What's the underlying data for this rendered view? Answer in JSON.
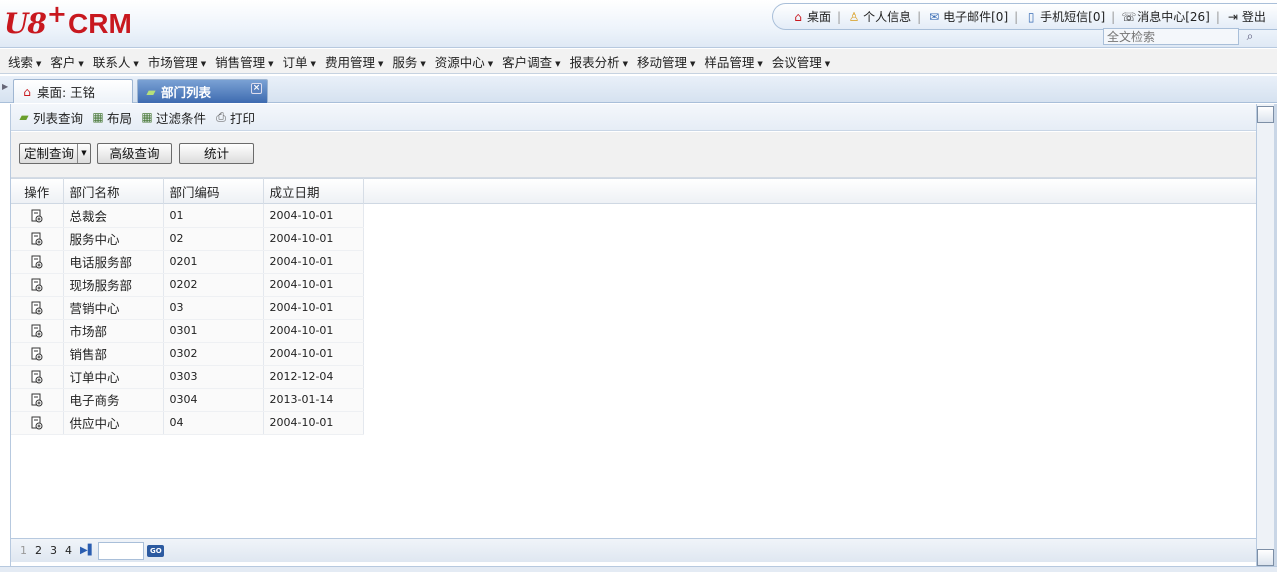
{
  "brand": {
    "u8": "U8",
    "plus": "+",
    "crm": "CRM"
  },
  "toplinks": [
    {
      "label": "桌面",
      "icon": "home-icon",
      "glyph": "⌂"
    },
    {
      "label": "个人信息",
      "icon": "user-icon",
      "glyph": "👤"
    },
    {
      "label": "电子邮件[0]",
      "icon": "mail-icon",
      "glyph": "✉"
    },
    {
      "label": "手机短信[0]",
      "icon": "phone-icon",
      "glyph": "📱"
    },
    {
      "label": "消息中心[26]",
      "icon": "message-center-icon",
      "glyph": "☏"
    },
    {
      "label": "登出",
      "icon": "logout-icon",
      "glyph": "⏻"
    }
  ],
  "search": {
    "placeholder": "全文检索"
  },
  "menu": [
    "线索",
    "客户",
    "联系人",
    "市场管理",
    "销售管理",
    "订单",
    "费用管理",
    "服务",
    "资源中心",
    "客户调查",
    "报表分析",
    "移动管理",
    "样品管理",
    "会议管理"
  ],
  "tabs": [
    {
      "label": "桌面: 王铭",
      "icon": "home-icon"
    },
    {
      "label": "部门列表",
      "icon": "list-icon"
    }
  ],
  "toolbar": {
    "list_query": "列表查询",
    "layout": "布局",
    "filter": "过滤条件",
    "print": "打印"
  },
  "query": {
    "custom": "定制查询",
    "advanced": "高级查询",
    "stats": "统计"
  },
  "table": {
    "headers": [
      "操作",
      "部门名称",
      "部门编码",
      "成立日期"
    ],
    "rows": [
      {
        "name": "总裁会",
        "code": "01",
        "date": "2004-10-01"
      },
      {
        "name": "服务中心",
        "code": "02",
        "date": "2004-10-01"
      },
      {
        "name": "电话服务部",
        "code": "0201",
        "date": "2004-10-01"
      },
      {
        "name": "现场服务部",
        "code": "0202",
        "date": "2004-10-01"
      },
      {
        "name": "营销中心",
        "code": "03",
        "date": "2004-10-01"
      },
      {
        "name": "市场部",
        "code": "0301",
        "date": "2004-10-01"
      },
      {
        "name": "销售部",
        "code": "0302",
        "date": "2004-10-01"
      },
      {
        "name": "订单中心",
        "code": "0303",
        "date": "2012-12-04"
      },
      {
        "name": "电子商务",
        "code": "0304",
        "date": "2013-01-14"
      },
      {
        "name": "供应中心",
        "code": "04",
        "date": "2004-10-01"
      }
    ]
  },
  "pager": {
    "pages": [
      "1",
      "2",
      "3",
      "4"
    ],
    "current": "1",
    "go": "GO"
  },
  "colors": {
    "brand_red": "#c8181f",
    "tab_active": "#3e6bb0"
  }
}
